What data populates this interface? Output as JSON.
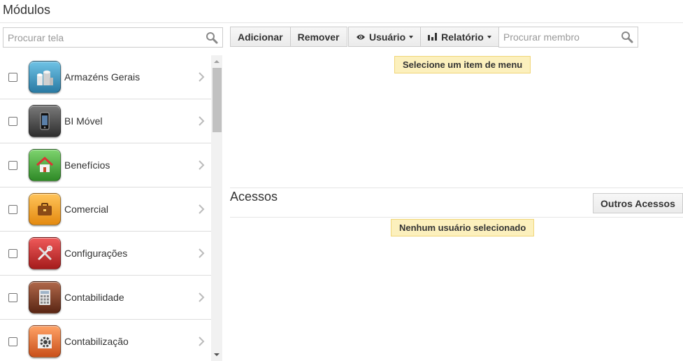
{
  "page": {
    "title": "Módulos"
  },
  "screen_search": {
    "placeholder": "Procurar tela"
  },
  "toolbar": {
    "add_label": "Adicionar",
    "remove_label": "Remover",
    "user_label": "Usuário",
    "report_label": "Relatório",
    "member_search_placeholder": "Procurar membro"
  },
  "modules": [
    {
      "label": "Armazéns Gerais",
      "icon": "warehouse-icon",
      "color": "#3a8fb5"
    },
    {
      "label": "BI Móvel",
      "icon": "mobile-phone-icon",
      "color": "#4a4a4a"
    },
    {
      "label": "Benefícios",
      "icon": "house-icon",
      "color": "#3f9c35"
    },
    {
      "label": "Comercial",
      "icon": "briefcase-icon",
      "color": "#f29a1f"
    },
    {
      "label": "Configurações",
      "icon": "tools-icon",
      "color": "#c9282d"
    },
    {
      "label": "Contabilidade",
      "icon": "calculator-icon",
      "color": "#7a3b25"
    },
    {
      "label": "Contabilização",
      "icon": "gear-icon",
      "color": "#e0712a"
    }
  ],
  "menu_notice": "Selecione um item de menu",
  "access": {
    "title": "Acessos",
    "other_button": "Outros Acessos",
    "notice": "Nenhum usuário selecionado"
  }
}
